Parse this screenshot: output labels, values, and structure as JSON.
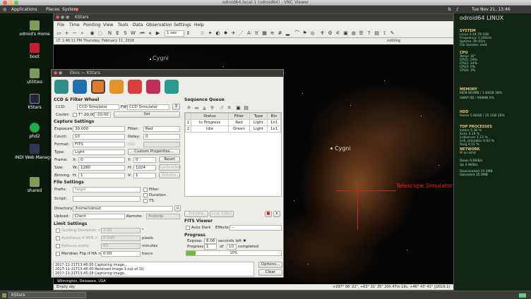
{
  "vnc": {
    "title": "odroid64.local:1 (odroid64) - VNC Viewer"
  },
  "top_panel": {
    "applications": "Applications",
    "places": "Places",
    "system": "System",
    "clock": "Tue Nov 21, 13:46"
  },
  "desktop_icons": [
    {
      "label": "odroid's Home"
    },
    {
      "label": "boot"
    },
    {
      "label": "utilities"
    },
    {
      "label": "KStars"
    },
    {
      "label": "phd2"
    },
    {
      "label": "INDI Web Manager"
    },
    {
      "label": "shared"
    }
  ],
  "kstars": {
    "title": "KStars",
    "menu": [
      "File",
      "Time",
      "Pointing",
      "View",
      "Tools",
      "Data",
      "Observation",
      "Settings",
      "Help"
    ],
    "time_step": "1 sec",
    "lt": "LT: 1:46:11 PM   Thursday, February 11, 2016",
    "focus": "nothing",
    "labels": {
      "star1": "Cygni",
      "star2": "Cygni",
      "telescope": "Telescope Simulator"
    },
    "status_left": "Empty sky",
    "location": "Wilmington, Delaware, USA",
    "status_right": "+297° 06' 22\", +63° 31' 35\"  20h 47m 16s, +46° 43' 43\" (J2016.1)"
  },
  "ekos": {
    "title": "Ekos — KStars",
    "section": "CCD & Filter Wheel",
    "ccd_label": "CCD:",
    "ccd_value": "CCD Simulator",
    "fw_label": "FW:",
    "fw_value": "CCD Simulator",
    "cooler_label": "Cooler:",
    "cooler_temp": "T° 20.00",
    "cooler_target": "-20.00",
    "set_label": "Set",
    "capture_settings": "Capture Settings",
    "exposure_label": "Exposure:",
    "exposure": "30.000",
    "filter_label": "Filter:",
    "filter": "Red",
    "count_label": "Count:",
    "count": "10",
    "delay_label": "Delay:",
    "delay": "0",
    "format_label": "Format:",
    "format": "FITS",
    "iso_label": "ISO:",
    "type_label": "Type:",
    "type": "Light",
    "custom_props": "Custom Properties...",
    "frame_label": "Frame:",
    "frame_x_label": "X:",
    "frame_x": "0",
    "frame_y_label": "Y:",
    "frame_y": "0",
    "reset": "Reset",
    "size_label": "Size:",
    "size_w_label": "W:",
    "size_w": "1280",
    "size_h_label": "H:",
    "size_h": "1024",
    "calibration": "Calibration",
    "binning_label": "Binning:",
    "bin_h_label": "H:",
    "bin_h": "1",
    "bin_v_label": "V:",
    "bin_v": "1",
    "rotator": "Rotator",
    "file_settings": "File Settings",
    "prefix_label": "Prefix:",
    "prefix_placeholder": "Target",
    "filter_cb": "Filter",
    "duration_cb": "Duration",
    "ts_cb": "TS",
    "script_label": "Script:",
    "directory_label": "Directory:",
    "directory": "/home/odroid",
    "upload_label": "Upload:",
    "upload": "Client",
    "remote_label": "Remote:",
    "remote_placeholder": "/home/pi",
    "limit_settings": "Limit Settings",
    "guiding_dev": "Guiding Deviation <",
    "guiding_dev_val": "2.00",
    "guiding_dev_unit": "\"",
    "autofocus": "Autofocus if HFR >",
    "autofocus_val": "0.500",
    "autofocus_unit": "pixels",
    "refocus": "Refocus every",
    "refocus_val": "60",
    "refocus_unit": "minutes",
    "meridian": "Meridian Flip if HA >",
    "meridian_val": "0.00",
    "meridian_unit": "hours",
    "sequence_queue": "Sequence Queue",
    "table_headers": [
      "Status",
      "Filter",
      "Type",
      "Bin"
    ],
    "table_rows": [
      {
        "idx": "1",
        "status": "In Progress",
        "filter": "Red",
        "type": "Light",
        "bin": "1x1"
      },
      {
        "idx": "2",
        "status": "Idle",
        "filter": "Green",
        "type": "Light",
        "bin": "1x1"
      }
    ],
    "preview": "Preview",
    "live_video": "Live Video",
    "fits_viewer": "FITS Viewer",
    "auto_dark": "Auto Dark",
    "effects_label": "Effects:",
    "effects": "--",
    "progress_header": "Progress",
    "expose_label": "Expose:",
    "expose_val": "8.08",
    "seconds_left": "seconds left",
    "progress_label": "Progress:",
    "progress_done": "1",
    "of": "of",
    "progress_total": "10",
    "completed": "completed",
    "progress_fraction": 0.1,
    "progress_pct": "10%",
    "log": [
      "2017-11-21T13:46:00 Capturing image...",
      "2017-11-21T13:46:00 Received image 1 out of 10.",
      "2017-11-21T13:45:28 Capturing image..."
    ],
    "options": "Options...",
    "clear": "Clear"
  },
  "conky": {
    "host": "odroid64",
    "os": "LINUX",
    "system": "SYSTEM",
    "sys_rows": [
      "Linux 3.14.79-108",
      "Frequency: 1.54GHz",
      "Uptime: 0h 05m",
      "File System: ext4"
    ],
    "cpu": "CPU",
    "cpu_rows": [
      "Temp: 35°",
      "CPU1: 59%",
      "CPU2: 24%",
      "CPU3: 0%",
      "CPU4: 3%"
    ],
    "memory": "MEMORY",
    "mem_rows": [
      "MEM 863MB / 1.84GB 38%",
      "SWAP 0B / 998MB 0%"
    ],
    "hdd": "HDD",
    "hdd_rows": [
      "Home 5.46GB / 25.1GB 26%"
    ],
    "top": "TOP PROCESSES",
    "top_rows": [
      "kstars 5.38 %",
      "Xvnc 3.19 %",
      "indiserver 1.23 %",
      "indi_simulator 0.93 %",
      "Xorg 0.51 %"
    ],
    "network": "NETWORK",
    "net_rows": [
      "IP on eth0",
      "Down 9.6KiB/s",
      "Up 4.9KiB/s",
      "Downloaded 19.3MB",
      "Uploaded 35.0MB"
    ]
  },
  "taskbar": {
    "item": "KStars"
  }
}
